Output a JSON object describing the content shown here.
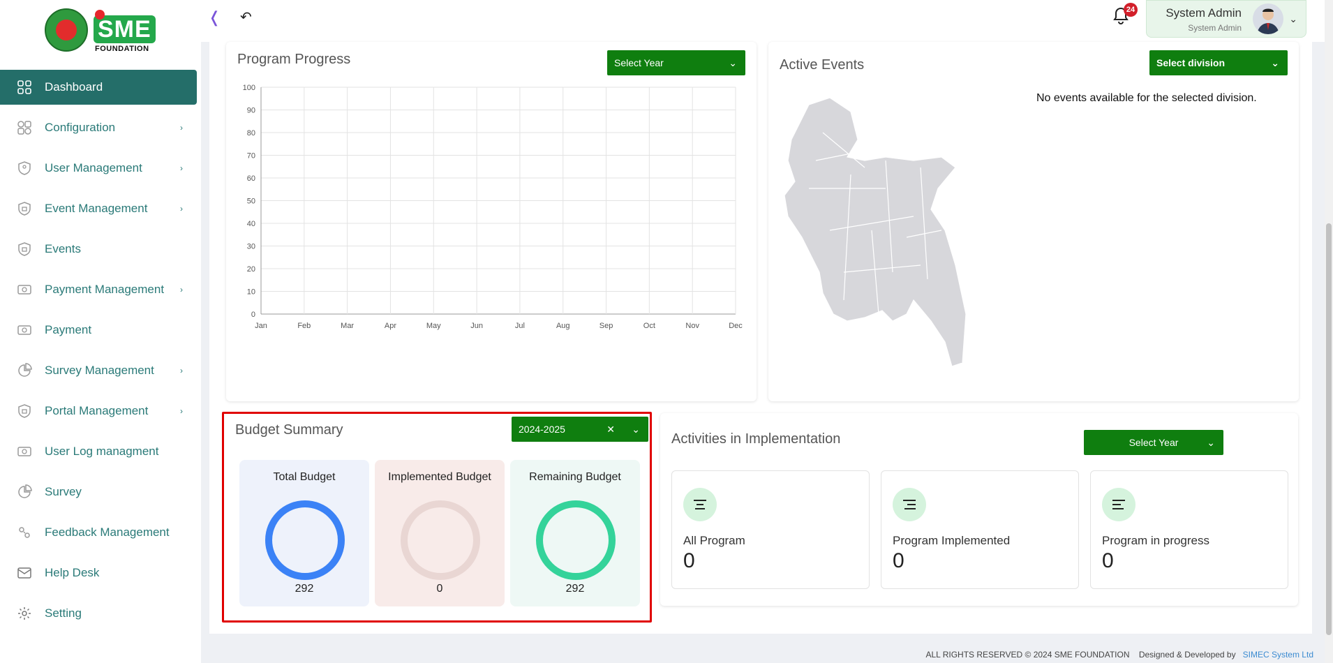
{
  "logo": {
    "text": "SME",
    "subtext": "FOUNDATION"
  },
  "sidebar": {
    "items": [
      {
        "label": "Dashboard",
        "icon": "grid-icon",
        "active": true
      },
      {
        "label": "Configuration",
        "icon": "config-icon",
        "arrow": true
      },
      {
        "label": "User Management",
        "icon": "user-shield-icon",
        "arrow": true
      },
      {
        "label": "Event Management",
        "icon": "lock-icon",
        "arrow": true
      },
      {
        "label": "Events",
        "icon": "lock-icon"
      },
      {
        "label": "Payment Management",
        "icon": "payment-icon",
        "arrow": true
      },
      {
        "label": "Payment",
        "icon": "payment-icon"
      },
      {
        "label": "Survey Management",
        "icon": "pie-icon",
        "arrow": true
      },
      {
        "label": "Portal Management",
        "icon": "lock-icon",
        "arrow": true
      },
      {
        "label": "User Log managment",
        "icon": "payment-icon"
      },
      {
        "label": "Survey",
        "icon": "pie-icon"
      },
      {
        "label": "Feedback Management",
        "icon": "feedback-icon"
      },
      {
        "label": "Help Desk",
        "icon": "mail-icon"
      },
      {
        "label": "Setting",
        "icon": "gear-icon"
      }
    ]
  },
  "topbar": {
    "notifications": "24",
    "user_name": "System Admin",
    "user_role": "System Admin"
  },
  "program_progress": {
    "title": "Program Progress",
    "select_label": "Select Year"
  },
  "chart_data": {
    "type": "line",
    "title": "",
    "categories": [
      "Jan",
      "Feb",
      "Mar",
      "Apr",
      "May",
      "Jun",
      "Jul",
      "Aug",
      "Sep",
      "Oct",
      "Nov",
      "Dec"
    ],
    "series": [],
    "ylim": [
      0,
      100
    ],
    "yticks": [
      0,
      10,
      20,
      30,
      40,
      50,
      60,
      70,
      80,
      90,
      100
    ],
    "grid": true
  },
  "active_events": {
    "title": "Active Events",
    "select_label": "Select division",
    "empty_message": "No events available for the selected division."
  },
  "budget_summary": {
    "title": "Budget Summary",
    "year": "2024-2025",
    "tiles": [
      {
        "label": "Total Budget",
        "value": "292",
        "bg": "#eef2fb",
        "ring": "#3b82f6"
      },
      {
        "label": "Implemented Budget",
        "value": "0",
        "bg": "#f8ebe9",
        "ring": "#e9d6d3"
      },
      {
        "label": "Remaining Budget",
        "value": "292",
        "bg": "#eef8f5",
        "ring": "#34d39a"
      }
    ]
  },
  "activities": {
    "title": "Activities in Implementation",
    "select_label": "Select Year",
    "stats": [
      {
        "label": "All Program",
        "value": "0"
      },
      {
        "label": "Program Implemented",
        "value": "0"
      },
      {
        "label": "Program in progress",
        "value": "0"
      }
    ]
  },
  "footer": {
    "rights": "ALL RIGHTS RESERVED © 2024 SME FOUNDATION",
    "designed": "Designed & Developed by",
    "company": "SIMEC System Ltd"
  },
  "colors": {
    "primary": "#246e69",
    "green": "#0f7e0f",
    "accent": "#3b82f6"
  }
}
